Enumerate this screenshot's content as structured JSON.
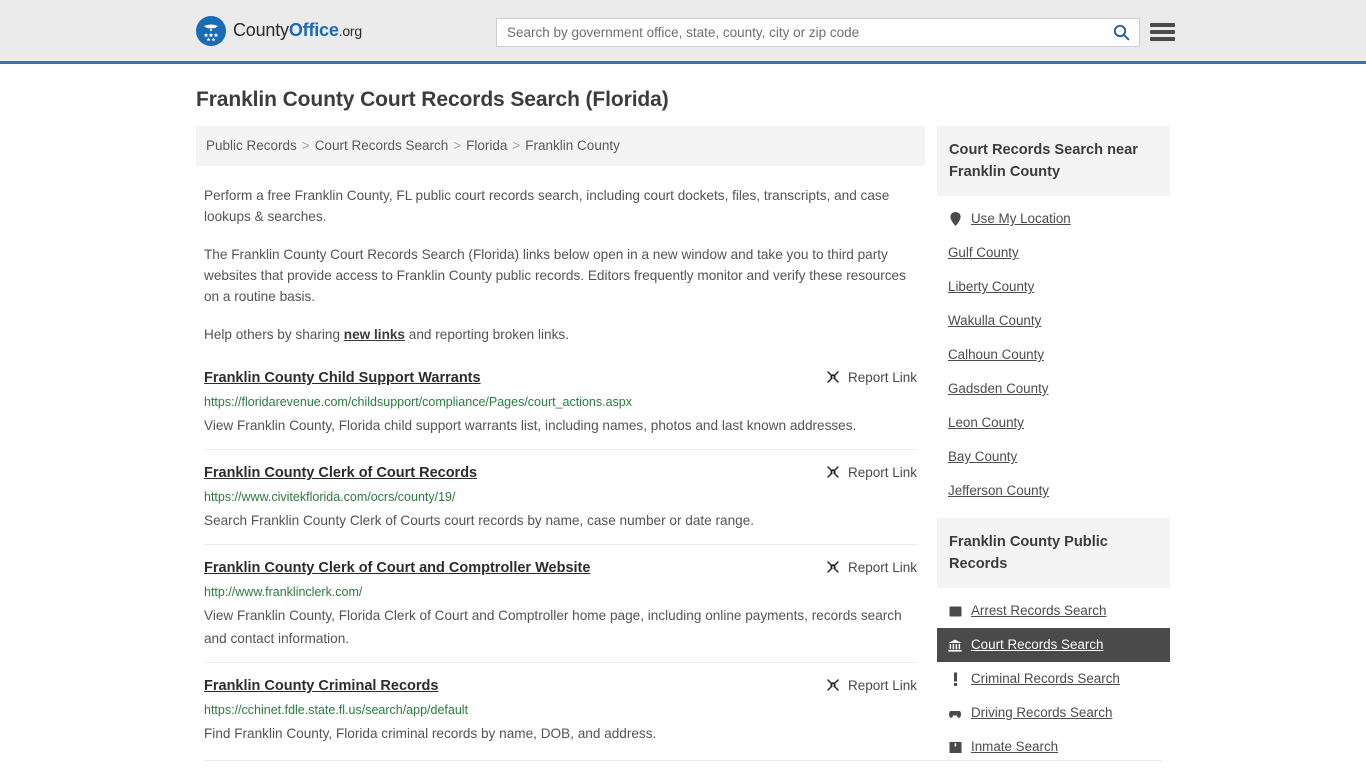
{
  "header": {
    "brand": {
      "part1": "County",
      "part2": "Office",
      "part3": ".org",
      "logo_icon": "eagle-stars-emblem"
    },
    "search": {
      "placeholder": "Search by government office, state, county, city or zip code",
      "value": "",
      "search_icon": "search-icon"
    },
    "menu_icon": "hamburger-menu-icon"
  },
  "page": {
    "title": "Franklin County Court Records Search (Florida)"
  },
  "breadcrumb": {
    "separator": ">",
    "items": [
      {
        "label": "Public Records"
      },
      {
        "label": "Court Records Search"
      },
      {
        "label": "Florida"
      },
      {
        "label": "Franklin County"
      }
    ]
  },
  "intro": {
    "p1": "Perform a free Franklin County, FL public court records search, including court dockets, files, transcripts, and case lookups & searches.",
    "p2": "The Franklin County Court Records Search (Florida) links below open in a new window and take you to third party websites that provide access to Franklin County public records. Editors frequently monitor and verify these resources on a routine basis.",
    "p3_before": "Help others by sharing ",
    "p3_link": "new links",
    "p3_after": " and reporting broken links."
  },
  "results": {
    "report_label": "Report Link",
    "report_icon": "broken-link-icon",
    "items": [
      {
        "title": "Franklin County Child Support Warrants",
        "url": "https://floridarevenue.com/childsupport/compliance/Pages/court_actions.aspx",
        "desc": "View Franklin County, Florida child support warrants list, including names, photos and last known addresses."
      },
      {
        "title": "Franklin County Clerk of Court Records",
        "url": "https://www.civitekflorida.com/ocrs/county/19/",
        "desc": "Search Franklin County Clerk of Courts court records by name, case number or date range."
      },
      {
        "title": "Franklin County Clerk of Court and Comptroller Website",
        "url": "http://www.franklinclerk.com/",
        "desc": "View Franklin County, Florida Clerk of Court and Comptroller home page, including online payments, records search and contact information."
      },
      {
        "title": "Franklin County Criminal Records",
        "url": "https://cchinet.fdle.state.fl.us/search/app/default",
        "desc": "Find Franklin County, Florida criminal records by name, DOB, and address."
      }
    ]
  },
  "sidebar": {
    "near_panel": {
      "title": "Court Records Search near Franklin County",
      "use_my_location": {
        "label": "Use My Location",
        "icon": "map-pin-icon"
      },
      "counties": [
        {
          "label": "Gulf County"
        },
        {
          "label": "Liberty County"
        },
        {
          "label": "Wakulla County"
        },
        {
          "label": "Calhoun County"
        },
        {
          "label": "Gadsden County"
        },
        {
          "label": "Leon County"
        },
        {
          "label": "Bay County"
        },
        {
          "label": "Jefferson County"
        }
      ]
    },
    "records_panel": {
      "title": "Franklin County Public Records",
      "items": [
        {
          "label": "Arrest Records Search",
          "icon": "fingerprint-icon",
          "active": false
        },
        {
          "label": "Court Records Search",
          "icon": "courthouse-icon",
          "active": true
        },
        {
          "label": "Criminal Records Search",
          "icon": "exclamation-icon",
          "active": false
        },
        {
          "label": "Driving Records Search",
          "icon": "car-icon",
          "active": false
        },
        {
          "label": "Inmate Search",
          "icon": "jail-icon",
          "active": false
        }
      ]
    }
  },
  "colors": {
    "brand_blue": "#1a6bb5",
    "header_bg": "#ebebeb",
    "header_rule": "#3a72a8",
    "panel_bg": "#f4f4f4",
    "url_green": "#2d7a3e",
    "active_bg": "#4a4a4a"
  }
}
